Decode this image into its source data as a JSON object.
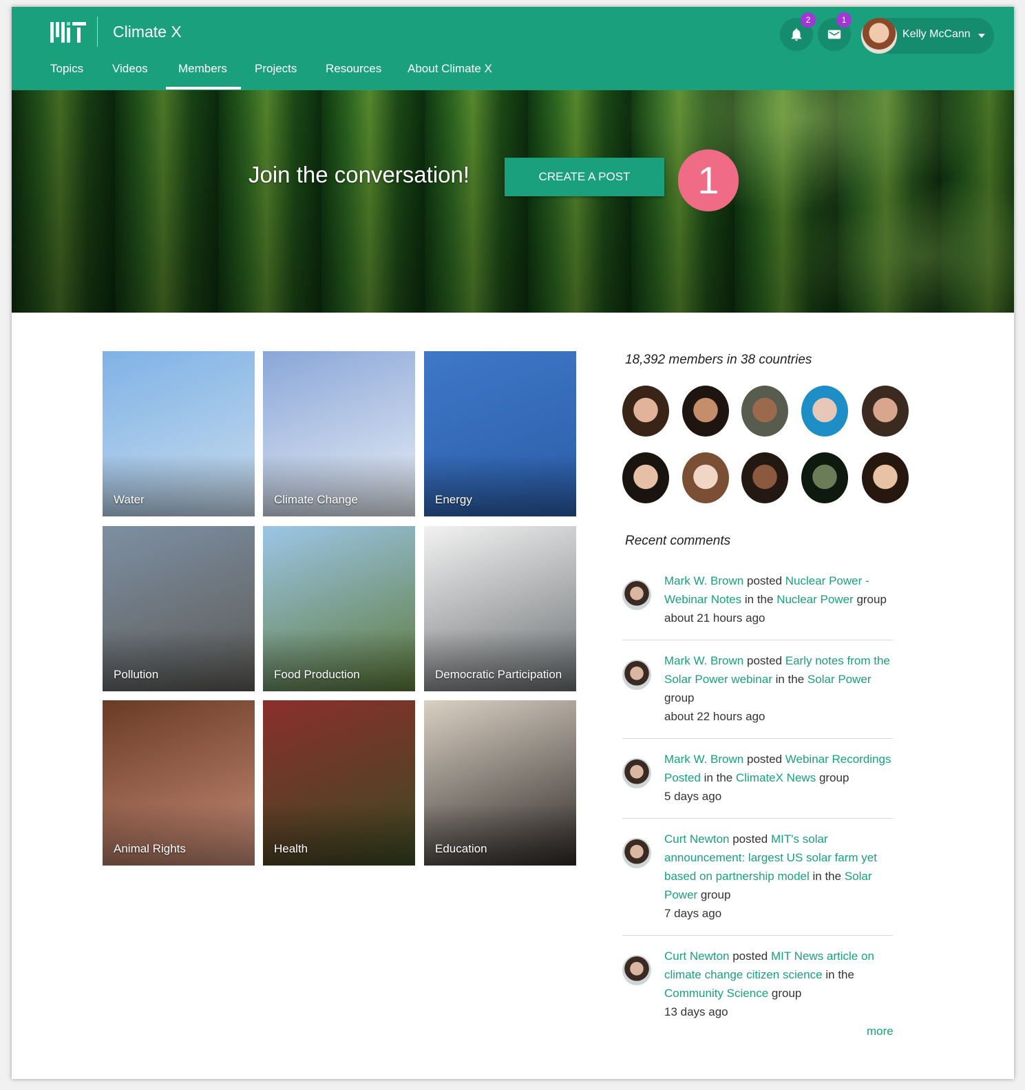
{
  "header": {
    "app_title": "Climate X",
    "nav": [
      "Topics",
      "Videos",
      "Members",
      "Projects",
      "Resources",
      "About Climate X"
    ],
    "active_nav": "Members",
    "notifications_count": "2",
    "messages_count": "1",
    "user_name": "Kelly McCann"
  },
  "hero": {
    "headline": "Join the conversation!",
    "cta_label": "CREATE A POST",
    "step_marker": "1"
  },
  "topics": [
    {
      "label": "Water",
      "colors": [
        "#7fb2e6",
        "#c8dced"
      ]
    },
    {
      "label": "Climate Change",
      "colors": [
        "#8aa6d8",
        "#e8eef5"
      ]
    },
    {
      "label": "Energy",
      "colors": [
        "#3f78c8",
        "#2a5da8"
      ]
    },
    {
      "label": "Pollution",
      "colors": [
        "#7d8fa3",
        "#5c5a55"
      ]
    },
    {
      "label": "Food Production",
      "colors": [
        "#9cc5e6",
        "#5d7a3a"
      ]
    },
    {
      "label": "Democratic Participation",
      "colors": [
        "#f2f2f2",
        "#6b6f72"
      ]
    },
    {
      "label": "Animal Rights",
      "colors": [
        "#6b3b26",
        "#c58b76"
      ]
    },
    {
      "label": "Health",
      "colors": [
        "#8b2f2c",
        "#3b4a22"
      ]
    },
    {
      "label": "Education",
      "colors": [
        "#d9d0c3",
        "#2f2a28"
      ]
    }
  ],
  "members": {
    "summary": "18,392 members in 38 countries"
  },
  "recent": {
    "title": "Recent comments",
    "more_label": "more",
    "posted_word": "posted",
    "in_the_word": "in the",
    "group_word": "group",
    "items": [
      {
        "author": "Mark W. Brown",
        "post": "Nuclear Power - Webinar Notes",
        "group": "Nuclear Power",
        "time": "about 21 hours ago"
      },
      {
        "author": "Mark W. Brown",
        "post": "Early notes from the Solar Power webinar",
        "group": "Solar Power",
        "time": "about 22 hours ago"
      },
      {
        "author": "Mark W. Brown",
        "post": "Webinar Recordings Posted",
        "group": "ClimateX News",
        "time": "5 days ago"
      },
      {
        "author": "Curt Newton",
        "post": "MIT's solar announcement: largest US solar farm yet based on partnership model",
        "group": "Solar Power",
        "time": "7 days ago"
      },
      {
        "author": "Curt Newton",
        "post": "MIT News article on climate change citizen science",
        "group": "Community Science",
        "time": "13 days ago"
      }
    ]
  },
  "colors": {
    "brand": "#1ba07e",
    "badge": "#a336d6",
    "step_marker": "#f06b86"
  }
}
